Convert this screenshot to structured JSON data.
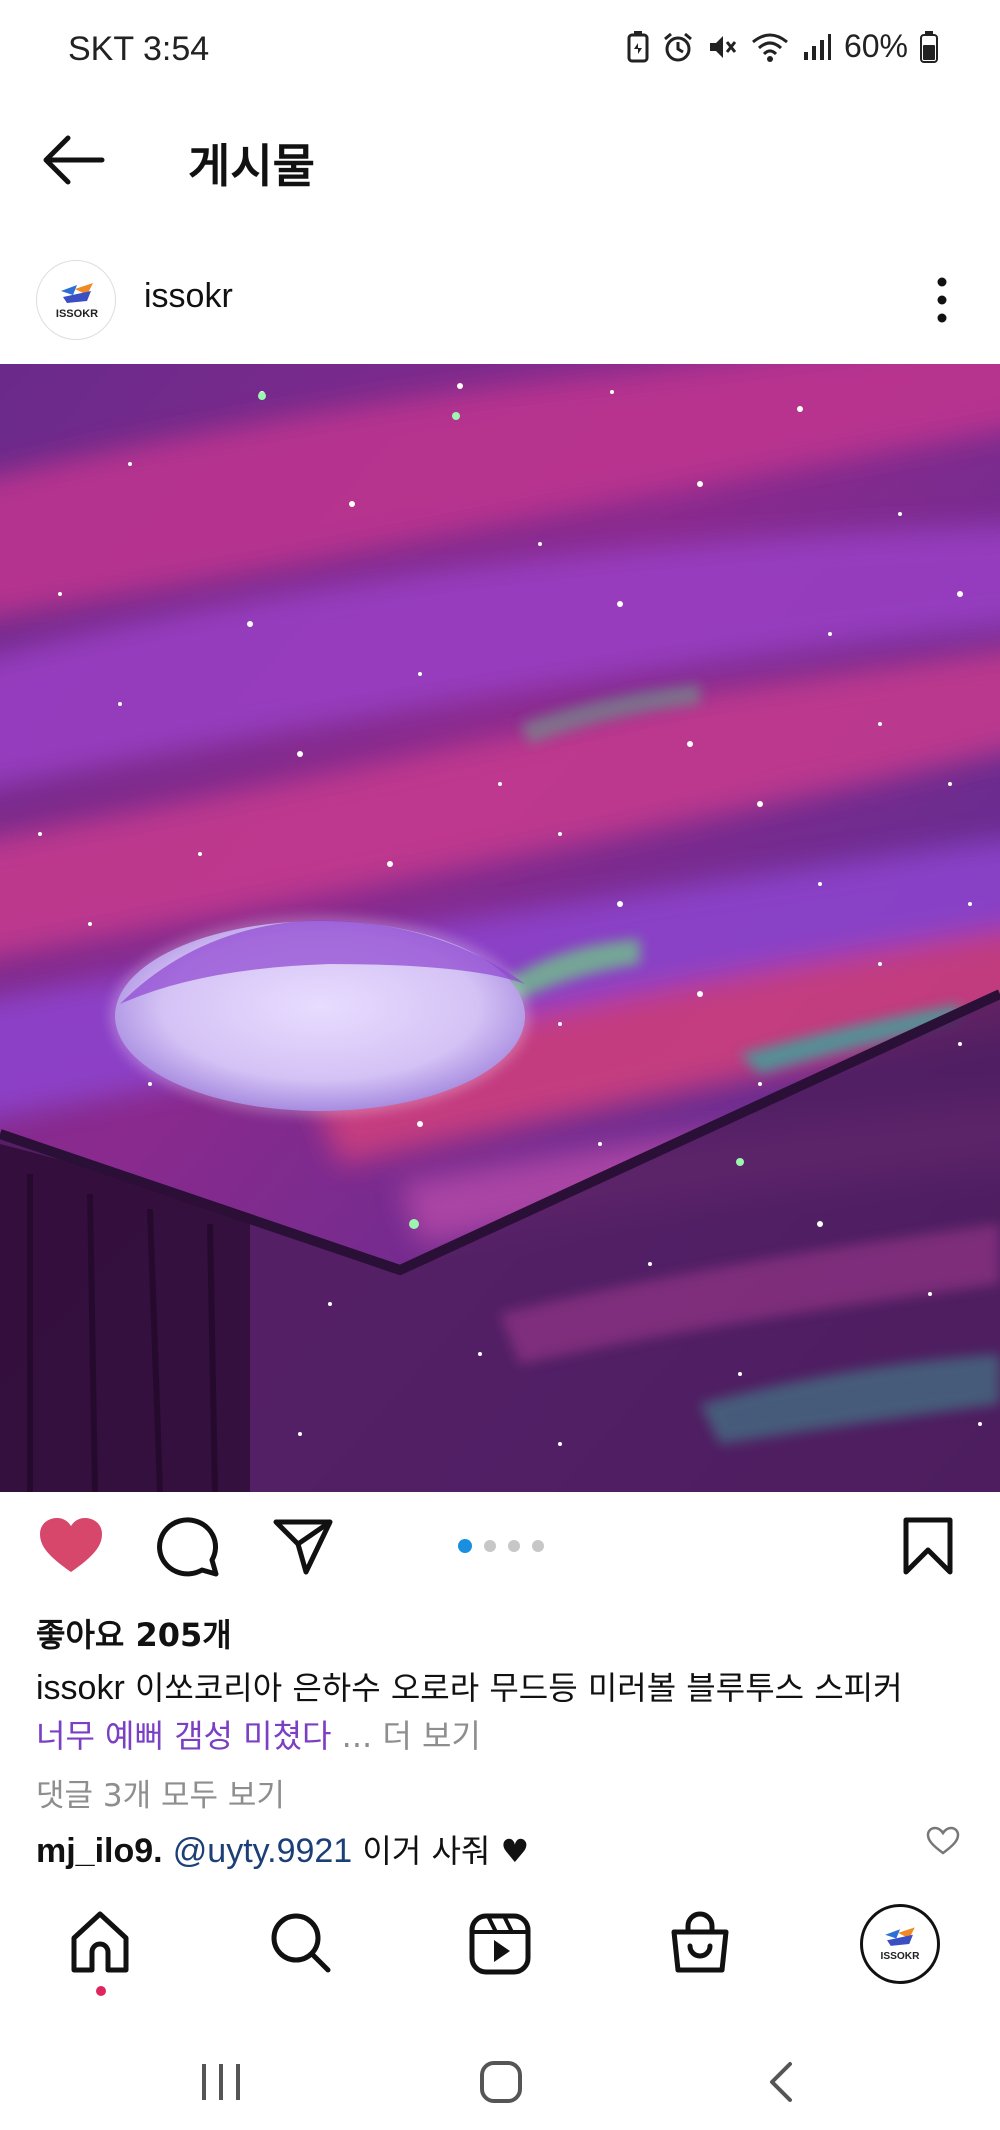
{
  "status_bar": {
    "carrier": "SKT",
    "time": "3:54",
    "battery": "60%",
    "icons": [
      "battery-saver-icon",
      "alarm-icon",
      "mute-icon",
      "wifi-icon",
      "signal-icon",
      "battery-icon"
    ]
  },
  "top_bar": {
    "title": "게시물",
    "back_icon": "arrow-left-icon"
  },
  "post": {
    "username": "issokr",
    "avatar_logo_text": "ISSOKR",
    "more_icon": "vertical-dots-icon",
    "image_description_icon": "aurora-projector-photo",
    "carousel": {
      "count": 4,
      "active_index": 0
    },
    "liked": true,
    "likes_text": "좋아요 205개",
    "caption": {
      "user": "issokr",
      "text": "이쏘코리아 은하수 오로라 무드등 미러볼 블루투스 스피커",
      "highlight": "너무 예뻐 갬성 미쳤다",
      "more": " ... 더 보기"
    },
    "view_comments": "댓글 3개 모두 보기",
    "comment": {
      "user": "mj_ilo9.",
      "mention": "@uyty.9921",
      "text": " 이거 사줘 ♥"
    }
  },
  "colors": {
    "like_red": "#d7476b",
    "carousel_active": "#1a8fe0",
    "caption_highlight": "#7b3fc4",
    "mention": "#1b3f76",
    "muted": "#8e8e8e"
  },
  "bottom_nav": {
    "items": [
      "home-icon",
      "search-icon",
      "reels-icon",
      "shop-icon",
      "profile-avatar"
    ],
    "active": "home-icon"
  },
  "system_nav": {
    "items": [
      "recent-apps-icon",
      "home-circle-icon",
      "back-chevron-icon"
    ]
  }
}
